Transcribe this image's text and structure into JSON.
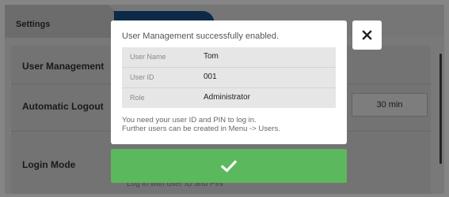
{
  "tabs": [
    {
      "label": "Settings"
    }
  ],
  "settings": {
    "rows": [
      {
        "label": "User Management"
      },
      {
        "label": "Automatic Logout",
        "value": "30 min"
      },
      {
        "label": "Login Mode",
        "note": "Log in with user ID and PIN"
      }
    ]
  },
  "dialog": {
    "title": "User Management successfully enabled.",
    "info": [
      {
        "key": "User Name",
        "value": "Tom"
      },
      {
        "key": "User ID",
        "value": "001"
      },
      {
        "key": "Role",
        "value": "Administrator"
      }
    ],
    "message_line1": "You need your user ID and PIN to log in.",
    "message_line2": "Further users can be created in Menu -> Users.",
    "close_icon": "close-icon",
    "confirm_icon": "checkmark-icon"
  },
  "colors": {
    "accent": "#1a4f8a",
    "confirm": "#5cb85c"
  }
}
